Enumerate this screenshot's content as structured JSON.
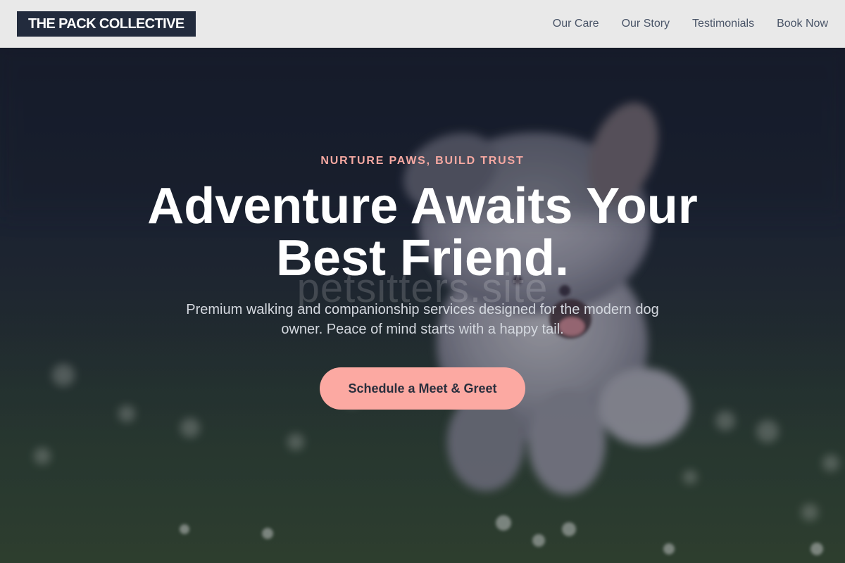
{
  "header": {
    "logo": "THE PACK COLLECTIVE",
    "nav": [
      {
        "label": "Our Care"
      },
      {
        "label": "Our Story"
      },
      {
        "label": "Testimonials"
      },
      {
        "label": "Book Now"
      }
    ]
  },
  "hero": {
    "eyebrow": "NURTURE PAWS, BUILD TRUST",
    "headline_line1": "Adventure Awaits Your",
    "headline_line2": "Best Friend.",
    "subtext": "Premium walking and companionship services designed for the modern dog owner. Peace of mind starts with a happy tail.",
    "cta_label": "Schedule a Meet & Greet",
    "watermark": "petsitters.site"
  },
  "colors": {
    "accent": "#fca9a2",
    "eyebrow": "#f7a9a2",
    "logo_bg": "#222b3d",
    "header_bg": "#e9e9e9"
  }
}
